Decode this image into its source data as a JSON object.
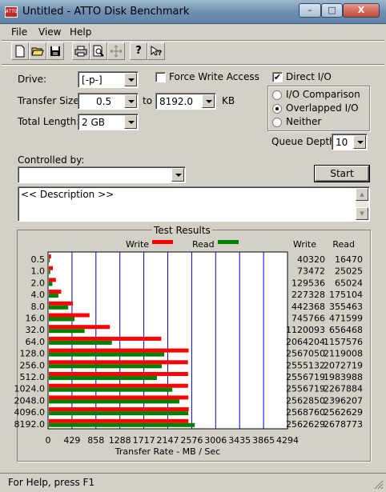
{
  "window": {
    "title": "Untitled - ATTO Disk Benchmark",
    "icon_text": "ATTO",
    "minimize_label": "–",
    "maximize_label": "□",
    "close_label": "X"
  },
  "menu": [
    "File",
    "View",
    "Help"
  ],
  "toolbar": {
    "icons": [
      "new-icon",
      "open-icon",
      "save-icon",
      "print-icon",
      "print-preview-icon",
      "move-icon",
      "help-icon",
      "context-help-icon"
    ]
  },
  "form": {
    "drive_label": "Drive:",
    "drive_value": "[-p-]",
    "force_write_label": "Force Write Access",
    "force_write_checked": false,
    "direct_io_label": "Direct I/O",
    "direct_io_checked": true,
    "transfer_size_label": "Transfer Size:",
    "transfer_from": "0.5",
    "to_label": "to",
    "transfer_to": "8192.0",
    "kb_label": "KB",
    "total_length_label": "Total Length:",
    "total_length_value": "2 GB",
    "io_options": [
      {
        "label": "I/O Comparison",
        "selected": false
      },
      {
        "label": "Overlapped I/O",
        "selected": true
      },
      {
        "label": "Neither",
        "selected": false
      }
    ],
    "queue_depth_label": "Queue Depth:",
    "queue_depth_value": "10",
    "controlled_by_label": "Controlled by:",
    "controlled_by_value": "",
    "start_label": "Start",
    "description_text": "<< Description >>"
  },
  "results": {
    "title": "Test Results",
    "legend_write": "Write",
    "legend_read": "Read",
    "col_write": "Write",
    "col_read": "Read",
    "write_color": "#ff0000",
    "read_color": "#008000",
    "grid_color": "#0000cc"
  },
  "chart_data": {
    "type": "bar",
    "orientation": "horizontal",
    "categories": [
      "0.5",
      "1.0",
      "2.0",
      "4.0",
      "8.0",
      "16.0",
      "32.0",
      "64.0",
      "128.0",
      "256.0",
      "512.0",
      "1024.0",
      "2048.0",
      "4096.0",
      "8192.0"
    ],
    "series": [
      {
        "name": "Write",
        "values": [
          40320,
          73472,
          129536,
          227328,
          442368,
          745766,
          1120093,
          2064204,
          2567050,
          2555132,
          2556719,
          2556719,
          2562850,
          2568760,
          2562629
        ]
      },
      {
        "name": "Read",
        "values": [
          16470,
          25025,
          65024,
          175104,
          355463,
          471599,
          656468,
          1157576,
          2119008,
          2072719,
          1983988,
          2267884,
          2396207,
          2562629,
          2678773
        ]
      }
    ],
    "xlabel": "Transfer Rate - MB / Sec",
    "xticks": [
      "0",
      "429",
      "858",
      "1288",
      "1717",
      "2147",
      "2576",
      "3006",
      "3435",
      "3865",
      "4294"
    ],
    "xlim": [
      0,
      4294
    ],
    "bar_unit_note": "",
    "grid": true,
    "legend": "top"
  },
  "status": {
    "text": "For Help, press F1"
  }
}
